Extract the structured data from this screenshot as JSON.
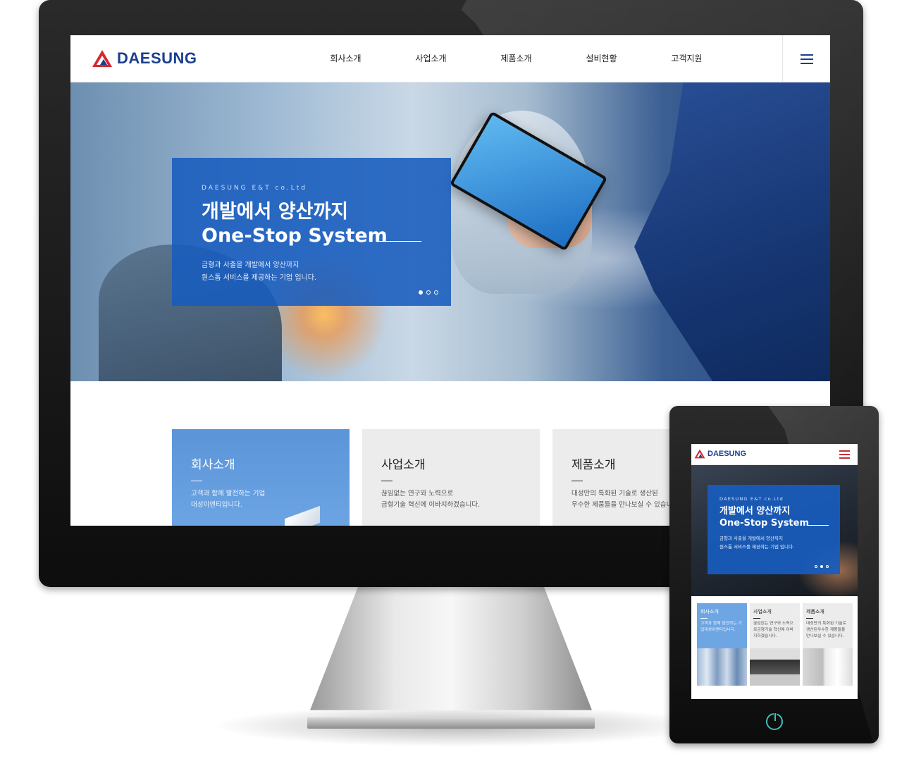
{
  "desktop": {
    "logo_text": "DAESUNG",
    "nav": [
      "회사소개",
      "사업소개",
      "제품소개",
      "설비현황",
      "고객지원"
    ],
    "hero": {
      "subtitle": "DAESUNG E&T co.Ltd",
      "title_line1": "개발에서 양산까지",
      "title_line2": "One-Stop System",
      "desc_line1": "금형과 사출을 개발에서 양산까지",
      "desc_line2": "원스톱 서비스를 제공하는 기업 입니다."
    },
    "cards": [
      {
        "title": "회사소개",
        "desc_line1": "고객과 함께 발전하는 기업",
        "desc_line2": "대성이엔티입니다."
      },
      {
        "title": "사업소개",
        "desc_line1": "끊임없는 연구와 노력으로",
        "desc_line2": "금형기술 혁신에 이바지하겠습니다."
      },
      {
        "title": "제품소개",
        "desc_line1": "대성만의 특화된 기술로 생산된",
        "desc_line2": "우수한 제품들을 만나보실 수 있습니"
      }
    ]
  },
  "tablet": {
    "logo_text": "DAESUNG",
    "hero": {
      "subtitle": "DAESUNG E&T co.Ltd",
      "title_line1": "개발에서 양산까지",
      "title_line2": "One-Stop System",
      "desc_line1": "금형과 사출을 개발에서 양산까지",
      "desc_line2": "원스톱 서비스를 제공하는 기업 입니다."
    },
    "cards": [
      {
        "title": "회사소개",
        "desc": "고객과 함께 발전하는 기업대성이엔티입니다."
      },
      {
        "title": "사업소개",
        "desc": "끊임없는 연구와 노력으로금형기술 혁신에 이바지하겠습니다."
      },
      {
        "title": "제품소개",
        "desc": "대성만의 특화된 기술로 생산된우수한 제품들을 만나보실 수 있습니다."
      }
    ]
  },
  "colors": {
    "brand_blue": "#1a3f8f",
    "logo_red": "#d7262f",
    "accent": "#185cbe",
    "power_teal": "#39c1b8"
  },
  "icons": [
    "daesung-logo-icon",
    "hamburger-menu-icon",
    "power-icon"
  ]
}
